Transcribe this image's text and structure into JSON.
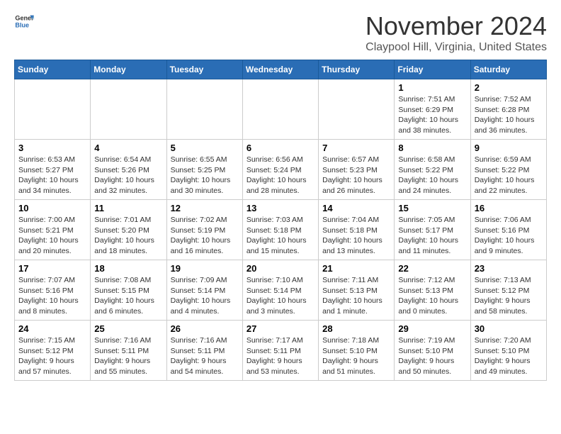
{
  "header": {
    "logo_general": "General",
    "logo_blue": "Blue",
    "month_title": "November 2024",
    "location": "Claypool Hill, Virginia, United States"
  },
  "days_of_week": [
    "Sunday",
    "Monday",
    "Tuesday",
    "Wednesday",
    "Thursday",
    "Friday",
    "Saturday"
  ],
  "weeks": [
    [
      {
        "day": "",
        "info": ""
      },
      {
        "day": "",
        "info": ""
      },
      {
        "day": "",
        "info": ""
      },
      {
        "day": "",
        "info": ""
      },
      {
        "day": "",
        "info": ""
      },
      {
        "day": "1",
        "info": "Sunrise: 7:51 AM\nSunset: 6:29 PM\nDaylight: 10 hours and 38 minutes."
      },
      {
        "day": "2",
        "info": "Sunrise: 7:52 AM\nSunset: 6:28 PM\nDaylight: 10 hours and 36 minutes."
      }
    ],
    [
      {
        "day": "3",
        "info": "Sunrise: 6:53 AM\nSunset: 5:27 PM\nDaylight: 10 hours and 34 minutes."
      },
      {
        "day": "4",
        "info": "Sunrise: 6:54 AM\nSunset: 5:26 PM\nDaylight: 10 hours and 32 minutes."
      },
      {
        "day": "5",
        "info": "Sunrise: 6:55 AM\nSunset: 5:25 PM\nDaylight: 10 hours and 30 minutes."
      },
      {
        "day": "6",
        "info": "Sunrise: 6:56 AM\nSunset: 5:24 PM\nDaylight: 10 hours and 28 minutes."
      },
      {
        "day": "7",
        "info": "Sunrise: 6:57 AM\nSunset: 5:23 PM\nDaylight: 10 hours and 26 minutes."
      },
      {
        "day": "8",
        "info": "Sunrise: 6:58 AM\nSunset: 5:22 PM\nDaylight: 10 hours and 24 minutes."
      },
      {
        "day": "9",
        "info": "Sunrise: 6:59 AM\nSunset: 5:22 PM\nDaylight: 10 hours and 22 minutes."
      }
    ],
    [
      {
        "day": "10",
        "info": "Sunrise: 7:00 AM\nSunset: 5:21 PM\nDaylight: 10 hours and 20 minutes."
      },
      {
        "day": "11",
        "info": "Sunrise: 7:01 AM\nSunset: 5:20 PM\nDaylight: 10 hours and 18 minutes."
      },
      {
        "day": "12",
        "info": "Sunrise: 7:02 AM\nSunset: 5:19 PM\nDaylight: 10 hours and 16 minutes."
      },
      {
        "day": "13",
        "info": "Sunrise: 7:03 AM\nSunset: 5:18 PM\nDaylight: 10 hours and 15 minutes."
      },
      {
        "day": "14",
        "info": "Sunrise: 7:04 AM\nSunset: 5:18 PM\nDaylight: 10 hours and 13 minutes."
      },
      {
        "day": "15",
        "info": "Sunrise: 7:05 AM\nSunset: 5:17 PM\nDaylight: 10 hours and 11 minutes."
      },
      {
        "day": "16",
        "info": "Sunrise: 7:06 AM\nSunset: 5:16 PM\nDaylight: 10 hours and 9 minutes."
      }
    ],
    [
      {
        "day": "17",
        "info": "Sunrise: 7:07 AM\nSunset: 5:16 PM\nDaylight: 10 hours and 8 minutes."
      },
      {
        "day": "18",
        "info": "Sunrise: 7:08 AM\nSunset: 5:15 PM\nDaylight: 10 hours and 6 minutes."
      },
      {
        "day": "19",
        "info": "Sunrise: 7:09 AM\nSunset: 5:14 PM\nDaylight: 10 hours and 4 minutes."
      },
      {
        "day": "20",
        "info": "Sunrise: 7:10 AM\nSunset: 5:14 PM\nDaylight: 10 hours and 3 minutes."
      },
      {
        "day": "21",
        "info": "Sunrise: 7:11 AM\nSunset: 5:13 PM\nDaylight: 10 hours and 1 minute."
      },
      {
        "day": "22",
        "info": "Sunrise: 7:12 AM\nSunset: 5:13 PM\nDaylight: 10 hours and 0 minutes."
      },
      {
        "day": "23",
        "info": "Sunrise: 7:13 AM\nSunset: 5:12 PM\nDaylight: 9 hours and 58 minutes."
      }
    ],
    [
      {
        "day": "24",
        "info": "Sunrise: 7:15 AM\nSunset: 5:12 PM\nDaylight: 9 hours and 57 minutes."
      },
      {
        "day": "25",
        "info": "Sunrise: 7:16 AM\nSunset: 5:11 PM\nDaylight: 9 hours and 55 minutes."
      },
      {
        "day": "26",
        "info": "Sunrise: 7:16 AM\nSunset: 5:11 PM\nDaylight: 9 hours and 54 minutes."
      },
      {
        "day": "27",
        "info": "Sunrise: 7:17 AM\nSunset: 5:11 PM\nDaylight: 9 hours and 53 minutes."
      },
      {
        "day": "28",
        "info": "Sunrise: 7:18 AM\nSunset: 5:10 PM\nDaylight: 9 hours and 51 minutes."
      },
      {
        "day": "29",
        "info": "Sunrise: 7:19 AM\nSunset: 5:10 PM\nDaylight: 9 hours and 50 minutes."
      },
      {
        "day": "30",
        "info": "Sunrise: 7:20 AM\nSunset: 5:10 PM\nDaylight: 9 hours and 49 minutes."
      }
    ]
  ]
}
